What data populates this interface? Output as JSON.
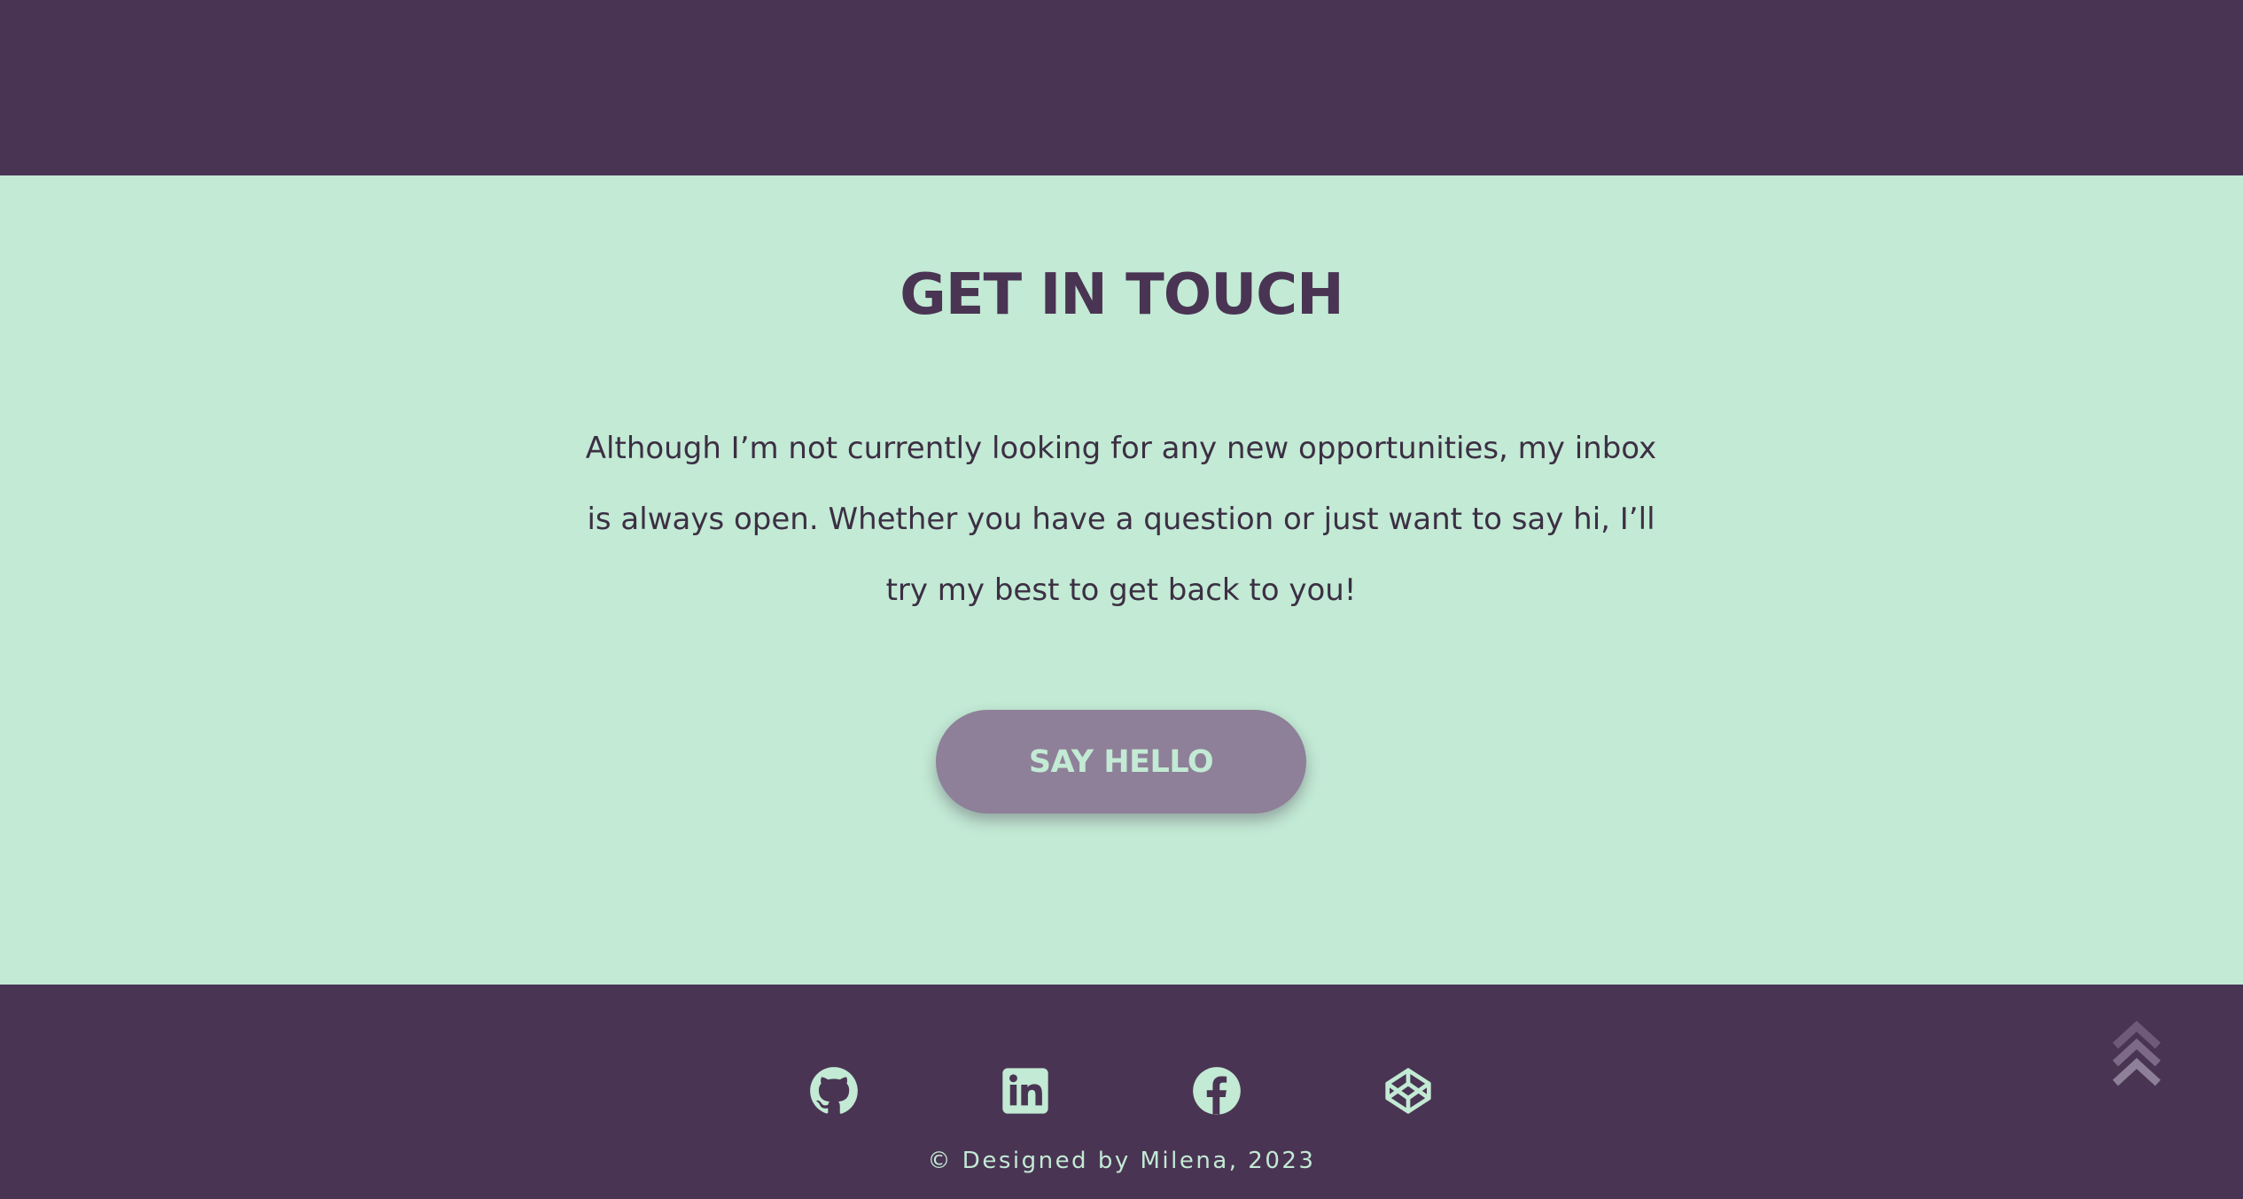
{
  "contact": {
    "title": "GET IN TOUCH",
    "text": "Although I’m not currently looking for any new opportunities, my inbox is always open. Whether you have a question or just want to say hi, I’ll try my best to get back to you!",
    "button_label": "SAY HELLO"
  },
  "footer": {
    "social_links": [
      {
        "icon": "github-icon"
      },
      {
        "icon": "linkedin-icon"
      },
      {
        "icon": "facebook-icon"
      },
      {
        "icon": "codepen-icon"
      }
    ],
    "copyright": "© Designed by Milena, 2023",
    "back_to_top_icon": "double-chevron-up-icon"
  },
  "colors": {
    "dark_purple": "#4a3453",
    "mint": "#c2ead4",
    "button_bg": "#8e8098",
    "text_dark": "#3c2f44"
  }
}
